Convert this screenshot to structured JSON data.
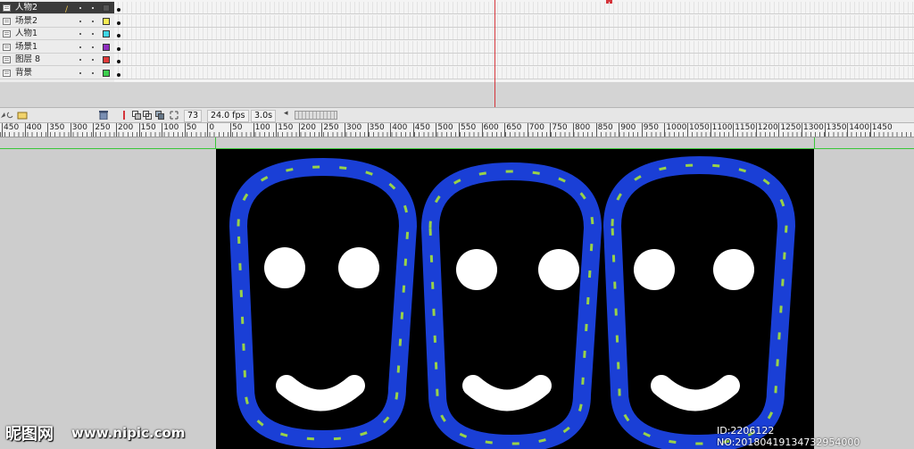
{
  "layers": [
    {
      "name": "人物2",
      "color": "#555555",
      "selected": true
    },
    {
      "name": "场景2",
      "color": "#f7ec52",
      "selected": false
    },
    {
      "name": "人物1",
      "color": "#3fd6e6",
      "selected": false
    },
    {
      "name": "场景1",
      "color": "#8e2fbf",
      "selected": false
    },
    {
      "name": "图层 8",
      "color": "#e03a3a",
      "selected": false
    },
    {
      "name": "背景",
      "color": "#3ccf4e",
      "selected": false
    }
  ],
  "timeline": {
    "current_frame": "73",
    "fps": "24.0 fps",
    "time": "3.0s"
  },
  "ruler": {
    "labels": [
      "450",
      "400",
      "350",
      "300",
      "250",
      "200",
      "150",
      "100",
      "50",
      "0",
      "50",
      "100",
      "150",
      "200",
      "250",
      "300",
      "350",
      "400",
      "450",
      "500",
      "550",
      "600",
      "650",
      "700",
      "750",
      "800",
      "850",
      "900",
      "950",
      "1000",
      "1050",
      "1100",
      "1150",
      "1200",
      "1250",
      "1300",
      "1350",
      "1400",
      "1450"
    ]
  },
  "stage": {
    "background": "#000000",
    "track_color": "#1a3fd6",
    "arrow_color": "#a6e23a",
    "face_color": "#ffffff"
  },
  "watermark": {
    "logo": "昵图网",
    "url": "www.nipic.com",
    "id_text": "ID:2206122 NO:20180419134732954000"
  }
}
